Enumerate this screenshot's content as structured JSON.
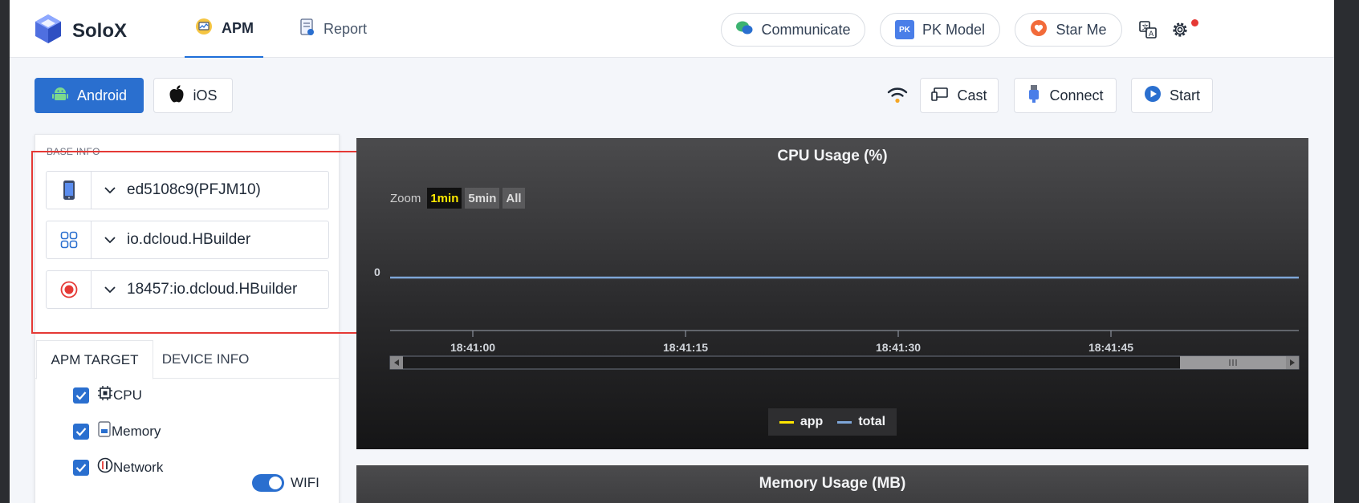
{
  "header": {
    "app_name": "SoloX",
    "tabs": [
      {
        "label": "APM",
        "active": true
      },
      {
        "label": "Report",
        "active": false
      }
    ],
    "actions": [
      {
        "label": "Communicate"
      },
      {
        "label": "PK Model",
        "badge": "PK"
      },
      {
        "label": "Star Me"
      }
    ]
  },
  "toolbar": {
    "platforms": [
      {
        "label": "Android",
        "active": true
      },
      {
        "label": "iOS",
        "active": false
      }
    ],
    "cast_label": "Cast",
    "connect_label": "Connect",
    "start_label": "Start"
  },
  "base_info": {
    "title": "BASE INFO",
    "device": "ed5108c9(PFJM10)",
    "package": "io.dcloud.HBuilder",
    "process": "18457:io.dcloud.HBuilder"
  },
  "panel_tabs": [
    {
      "label": "APM TARGET",
      "active": true
    },
    {
      "label": "DEVICE INFO",
      "active": false
    }
  ],
  "targets": [
    {
      "label": "CPU",
      "checked": true
    },
    {
      "label": "Memory",
      "checked": true
    },
    {
      "label": "Network",
      "checked": true
    }
  ],
  "network_toggle": {
    "label": "WIFI",
    "on": true
  },
  "colors": {
    "accent": "#2a6fcf",
    "highlight": "#e53935",
    "app_series": "#ffe600",
    "total_series": "#7ea6d8"
  },
  "charts": {
    "cpu": {
      "zoom_label": "Zoom",
      "zoom_options": [
        "1min",
        "5min",
        "All"
      ],
      "zoom_selected": "1min"
    },
    "memory": {
      "title": "Memory Usage (MB)"
    }
  },
  "chart_data": {
    "type": "line",
    "title": "CPU Usage (%)",
    "xlabel": "",
    "ylabel": "",
    "x_ticks": [
      "18:41:00",
      "18:41:15",
      "18:41:30",
      "18:41:45"
    ],
    "y_ticks": [
      "0"
    ],
    "series": [
      {
        "name": "app",
        "color": "#ffe600",
        "values": [
          0,
          0
        ]
      },
      {
        "name": "total",
        "color": "#7ea6d8",
        "values": [
          0,
          0
        ]
      }
    ],
    "legend_position": "bottom-center",
    "grid": false
  }
}
